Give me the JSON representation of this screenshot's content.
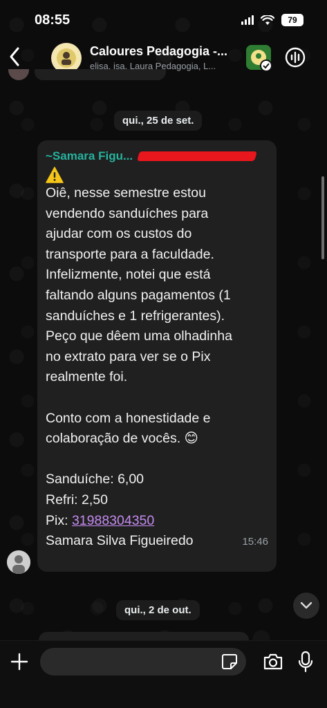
{
  "status_bar": {
    "time": "08:55",
    "battery": "79"
  },
  "header": {
    "group_name": "Caloures Pedagogia -...",
    "members": "elisa, isa, Laura Pedagogia, L..."
  },
  "dates": {
    "first": "qui., 25 de set.",
    "second": "qui., 2 de out."
  },
  "message": {
    "sender_name": "~Samara Figu...",
    "body": "Oiê, nesse semestre estou\nvendendo sanduíches para\najudar com os custos do\ntransporte para a faculdade.\nInfelizmente, notei que está\nfaltando alguns pagamentos (1\nsanduíches e 1 refrigerantes).\nPeço que dêem uma olhadinha\nno extrato para ver se o Pix\nrealmente foi.\n\nConto com a honestidade e\ncolaboração de vocês. 😊\n\nSanduíche: 6,00\nRefri: 2,50\n",
    "pix_label": "Pix: ",
    "pix_number": "31988304350",
    "signature": "Samara Silva Figueiredo",
    "time": "15:46"
  },
  "input": {
    "placeholder": ""
  },
  "colors": {
    "sender": "#25b39e",
    "link": "#c48bf0",
    "redaction": "#e8161d"
  }
}
